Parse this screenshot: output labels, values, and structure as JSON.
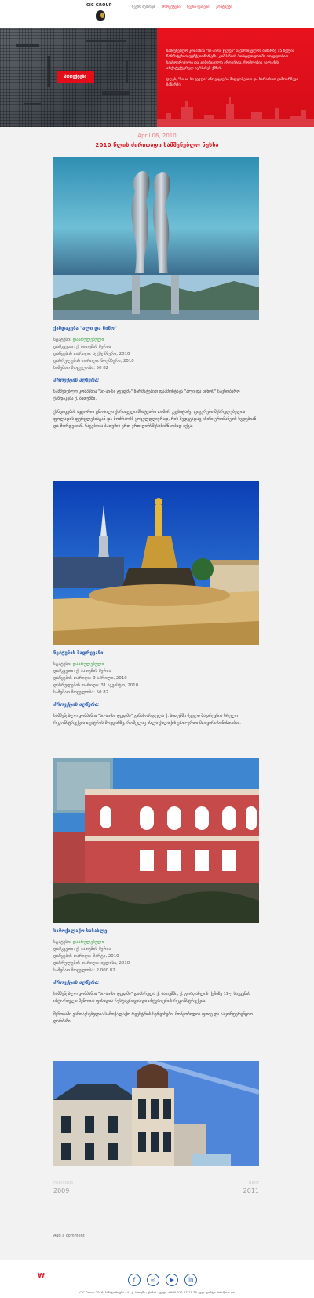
{
  "header": {
    "logo_text": "CIC GROUP",
    "nav": [
      "ჩვენს შესახებ",
      "პროექტები",
      "ჩვენი ფასები",
      "კონტაქტი"
    ]
  },
  "hero": {
    "button": "პროექტები",
    "para1": "სამშენებლო კომპანია \"სი-აი-სი ჯგუფი\" საქართველოს ბაზარზე 15 წელია წარმატებით ფუნქციონირებს. კომპანიის პორტფოლიოში ათეულობით საცხოვრებელი და კომერციული პროექტია, რომლებიც ქალაქის არქიტექტურულ იერსახეს ქმნის.",
    "para2": "დღეს, \"სი-აი-სი ჯგუფი\" ინოვაციური მიდგომებით და ხარისხით გამოირჩევა ბაზარზე."
  },
  "article": {
    "date": "April 06, 2010",
    "title": "2010 წლის ძირითადი სამშენებლო ნუსხა"
  },
  "projects": [
    {
      "name": "ქანდაკება \"ალი და ნინო\"",
      "info": [
        {
          "label": "სტატუსი:",
          "value": "დასრულებული"
        },
        {
          "label": "დამკვეთი:",
          "value": "ქ. ბათუმის მერია"
        },
        {
          "label": "დაწყების თარიღი:",
          "value": "სექტემბერი, 2010"
        },
        {
          "label": "დასრულების თარიღი:",
          "value": "ნოემბერი, 2010"
        },
        {
          "label": "სამუშაო მოცულობა:",
          "value": "50 82"
        }
      ],
      "desc_title": "პროექტის აღწერა:",
      "desc": [
        "სამშენებლო კომპანია \"სი-აი-სი ჯგუფმა\" წარმატებით დაამონტაჟა \"ალი და ნინოს\" საცნობარო ქანდაკება ქ. ბათუმში.",
        "ქანდაკების ავტორია ცნობილი ქართველი მხატვარი თამარ კვესიტაძე. ფიგურები შესრულებულია ფოლადის ფურცლებისგან და მოძრაობს ყოველდღიურად, რის შედეგადაც ისინი ერთმანეთს ხვდებიან და შორდებიან. ნაგებობა ბათუმის ერთ-ერთ ღირსშესანიშნაობად იქცა."
      ]
    },
    {
      "name": "ნეპტუნის შადრევანი",
      "info": [
        {
          "label": "სტატუსი:",
          "value": "დასრულებული"
        },
        {
          "label": "დამკვეთი:",
          "value": "ქ. ბათუმის მერია"
        },
        {
          "label": "დაწყების თარიღი:",
          "value": "9 აპრილი, 2010"
        },
        {
          "label": "დასრულების თარიღი:",
          "value": "31 აგვისტო, 2010"
        },
        {
          "label": "სამუშაო მოცულობა:",
          "value": "50 82"
        }
      ],
      "desc_title": "პროექტის აღწერა:",
      "desc": [
        "სამშენებლო კომპანია \"სი-აი-სი ჯგუფმა\" განახორციელა ქ. ბათუმში ძველი შადრევნის სრული რეკონსტრუქცია თეატრის მოედანზე, რომელიც ახლა ქალაქის ერთ-ერთი მთავარი სანახაობაა."
      ]
    },
    {
      "name": "სამოქალაქო სასახლე",
      "info": [
        {
          "label": "სტატუსი:",
          "value": "დასრულებული"
        },
        {
          "label": "დამკვეთი:",
          "value": "ქ. ბათუმის მერია"
        },
        {
          "label": "დაწყების თარიღი:",
          "value": "მარტი, 2010"
        },
        {
          "label": "დასრულების თარიღი:",
          "value": "ივლისი, 2010"
        },
        {
          "label": "სამუშაო მოცულობა:",
          "value": "2 000 82"
        }
      ],
      "desc_title": "პროექტის აღწერა:",
      "desc": [
        "სამშენებლო კომპანია \"სი-აი-სი ჯგუფმა\" დაასრულა ქ. ბათუმში, ქ. გორგასლის ქუჩაზე 19-ე საუკუნის ისტორიული შენობის ფასადის რესტავრაცია და ინტერიერის რეკონსტრუქცია.",
        "შენობაში განთავსებულია სამოქალაქო რეესტრის სერვისები, მოწყობილია ფოიე და საკონფერენციო დარბაზი."
      ]
    }
  ],
  "pager": {
    "prev_label": "PREVIOUS",
    "prev_year": "2009",
    "next_label": "NEXT",
    "next_year": "2011"
  },
  "comment_link": "Add a comment",
  "footer": {
    "icon": "₩",
    "socials": [
      "f",
      "◎",
      "▶",
      "in"
    ],
    "copyright": "CIC Group 2016. სანატორიუმი 44 · ქ. ბათუმი · ქოზია · ტელ: +995 422 27 11 76 · ელ.ფოსტა: info@cic.ge"
  }
}
